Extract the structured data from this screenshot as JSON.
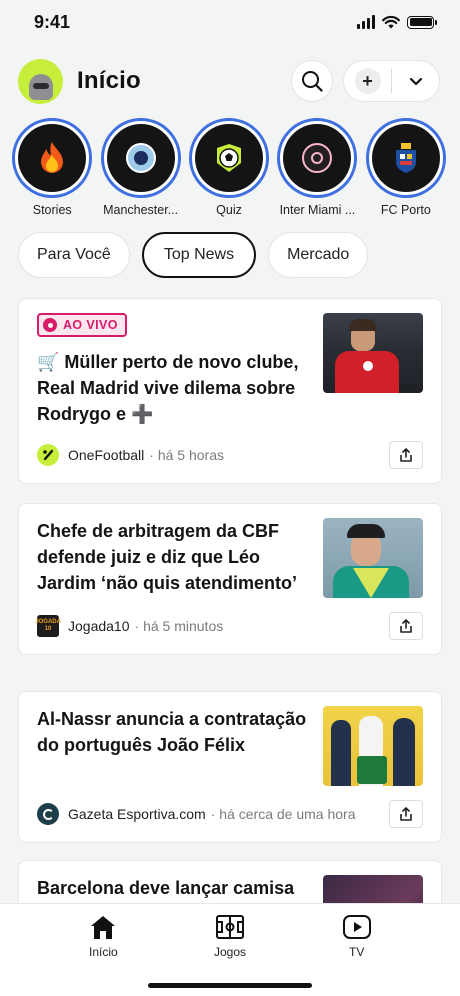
{
  "status_bar": {
    "time": "9:41"
  },
  "header": {
    "title": "Início"
  },
  "stories": [
    {
      "label": "Stories",
      "icon": "fire-icon"
    },
    {
      "label": "Manchester...",
      "icon": "manchester-city-crest-icon"
    },
    {
      "label": "Quiz",
      "icon": "soccer-ball-icon"
    },
    {
      "label": "Inter Miami ...",
      "icon": "inter-miami-crest-icon"
    },
    {
      "label": "FC Porto",
      "icon": "fc-porto-crest-icon"
    }
  ],
  "tabs": [
    {
      "label": "Para Você",
      "active": false
    },
    {
      "label": "Top News",
      "active": true
    },
    {
      "label": "Mercado",
      "active": false
    }
  ],
  "feed": [
    {
      "badge": "AO VIVO",
      "headline": "🛒 Müller perto de novo clube, Real Madrid vive dilema sobre Rodrygo e ➕",
      "source": "OneFootball",
      "time": "· há 5 horas",
      "source_logo_text": ""
    },
    {
      "headline": "Chefe de arbitragem da CBF defende juiz e diz que Léo Jardim ‘não quis atendimento’",
      "source": "Jogada10",
      "time": "· há 5 minutos",
      "source_logo_text": "JOGADA 10"
    },
    {
      "headline": "Al-Nassr anuncia a contratação do português João Félix",
      "source": "Gazeta Esportiva.com",
      "time": "· há cerca de uma hora",
      "source_logo_text": ""
    },
    {
      "headline": "Barcelona deve lançar camisa"
    }
  ],
  "bottom_nav": [
    {
      "label": "Início",
      "icon": "home-icon"
    },
    {
      "label": "Jogos",
      "icon": "pitch-icon"
    },
    {
      "label": "TV",
      "icon": "play-icon"
    }
  ],
  "colors": {
    "accent_blue": "#3f6fe0",
    "live_pink": "#d81b6a",
    "avatar_lime": "#c6ee3a"
  }
}
